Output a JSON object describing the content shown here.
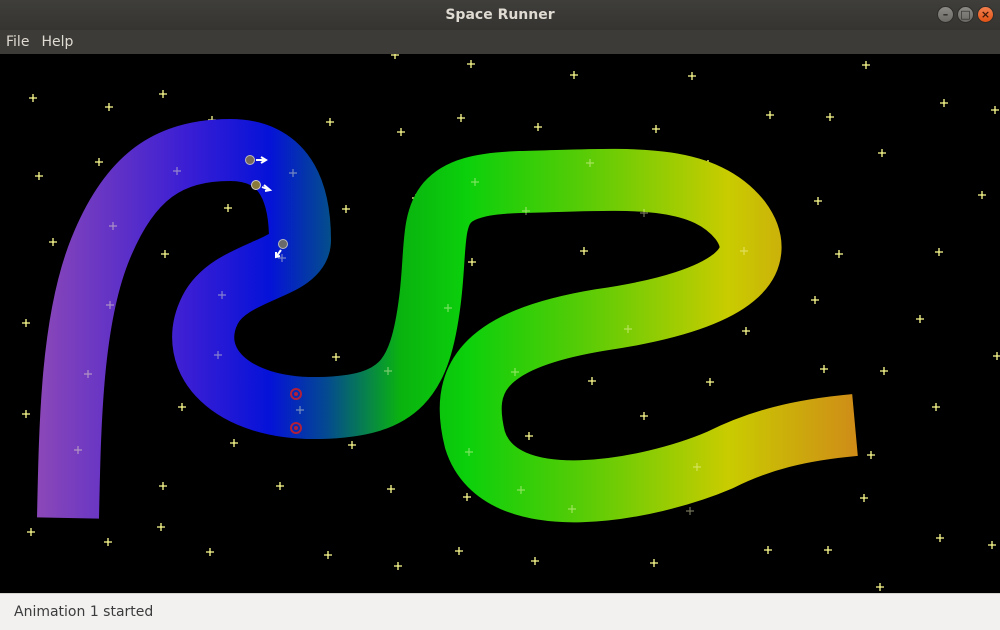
{
  "window": {
    "title": "Space Runner"
  },
  "menu": {
    "items": [
      "File",
      "Help"
    ]
  },
  "status": {
    "text": "Animation 1 started"
  },
  "colors": {
    "track_start": "#8a47b8",
    "track_blue": "#0512d8",
    "track_green": "#0bd00b",
    "track_yellow": "#c9cc00",
    "track_end": "#cf8a18",
    "star": "#ffff90",
    "space": "#000000"
  }
}
